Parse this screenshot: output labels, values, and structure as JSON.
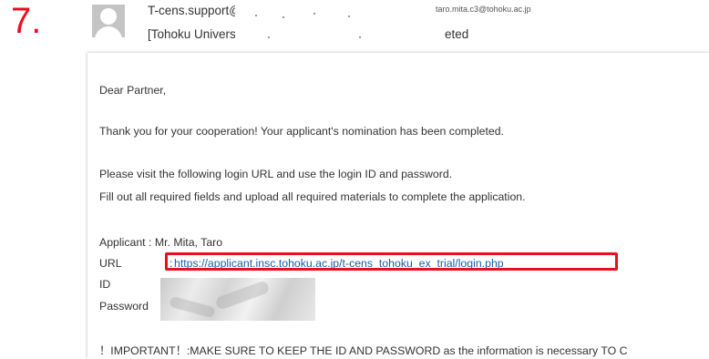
{
  "step_number": "7.",
  "header": {
    "sender": "T-cens.support@appli",
    "recipient": "taro.mita.c3@tohoku.ac.jp",
    "subject_start": "[Tohoku University T-",
    "subject_end": "eted"
  },
  "body": {
    "greeting": "Dear Partner,",
    "thanks": "Thank you for your cooperation! Your applicant's nomination has been completed.",
    "instruction1": "Please visit the following login URL and use the login ID and password.",
    "instruction2": "Fill out all required fields and upload all required materials to complete the application.",
    "applicant_line": "Applicant : Mr. Mita, Taro",
    "url_label": "URL",
    "url_colon": ":",
    "url": "https://applicant.insc.tohoku.ac.jp/t-cens_tohoku_ex_trial/login.php",
    "id_label": "ID",
    "password_label": "Password",
    "important": "！IMPORTANT！:MAKE SURE TO KEEP THE ID AND PASSWORD as the information is necessary TO C"
  },
  "colors": {
    "highlight": "#e8101d",
    "link": "#1a5fa8"
  }
}
